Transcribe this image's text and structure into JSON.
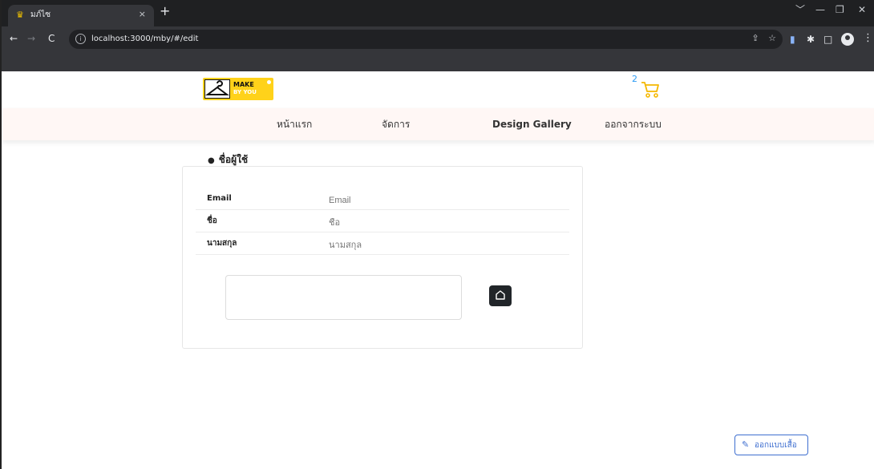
{
  "browser": {
    "tab_favicon": "hanger-favicon-icon",
    "tab_title": "มภ์ไซ",
    "tab_close": "×",
    "new_tab": "+",
    "window_controls": [
      "﹀",
      "—",
      "❐",
      "✕"
    ],
    "nav_buttons": [
      "←",
      "→",
      "C"
    ],
    "url": "localhost:3000/mby/#/edit",
    "omnibox_icons": [
      "⇪",
      "☆"
    ],
    "extension_icons": [
      "▮",
      "✱",
      "□"
    ]
  },
  "site": {
    "logo": {
      "make": "MAKE",
      "byyou": "BY YOU"
    },
    "cart": {
      "count": "2",
      "icon": "cart-icon"
    },
    "nav": [
      "หน้าแรก",
      "จัดการ",
      "Design Gallery",
      "ออกจากระบบ"
    ]
  },
  "profile": {
    "title": "ชื่อผู้ใช้",
    "title_icon": "user-icon",
    "fields": [
      {
        "label": "Email",
        "placeholder": "Email"
      },
      {
        "label": "ชื่อ",
        "placeholder": "ชื่อ"
      },
      {
        "label": "นามสกุล",
        "placeholder": "นามสกุล"
      }
    ]
  },
  "design_button": {
    "label": "ออกแบบเสื้อ",
    "icon": "pencil-icon"
  }
}
